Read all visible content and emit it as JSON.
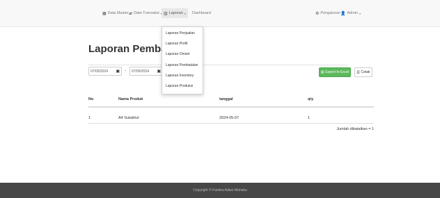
{
  "nav": {
    "data_master": "Data Master",
    "data_transaksi": "Data Transaksi",
    "laporan": "Laporan",
    "dashboard": "Dashboard",
    "pengaturan": "Pengaturan",
    "admin": "Admin",
    "dropdown": [
      "Laporan Penjualan",
      "Laporan Profit",
      "Laporan Omset",
      "Laporan Pembatalan",
      "Laporan Inventory",
      "Laporan Produksi"
    ]
  },
  "page": {
    "title": "Laporan Pembatalan P"
  },
  "filters": {
    "date_from": "07/05/2024",
    "date_to": "07/05/2024",
    "separator": "-",
    "export_label": "Export to Excel",
    "print_label": "Cetak"
  },
  "table": {
    "headers": [
      "No",
      "Nama Produk",
      "tanggal",
      "qty"
    ],
    "rows": [
      [
        "1",
        "A4 Sutakhul",
        "2024-05-07",
        "1"
      ]
    ],
    "total_label": "Jumlah dibatalkan = 1"
  },
  "footer": {
    "text": "Copyright © Fariska Adam Muhaka"
  },
  "colors": {
    "navbar": "#f8f8f8",
    "excel_button": "#5cb85c",
    "footer": "#474747"
  }
}
